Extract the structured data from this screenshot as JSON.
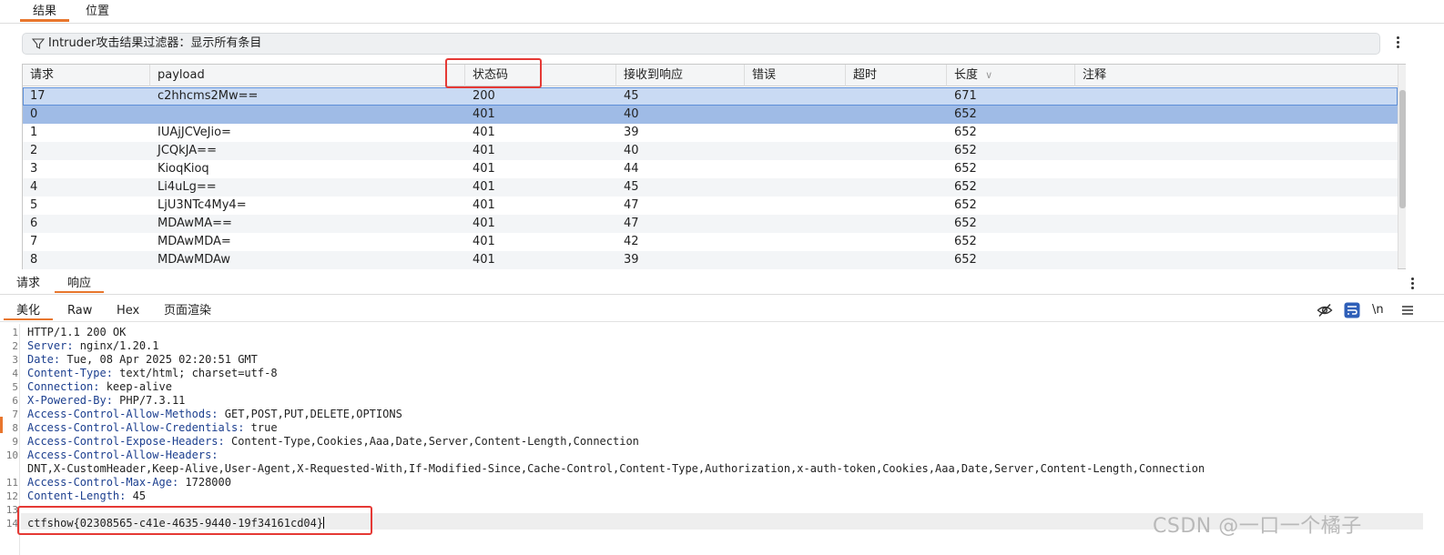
{
  "top_tabs": [
    {
      "label": "结果"
    },
    {
      "label": "位置"
    }
  ],
  "filter": {
    "text": "Intruder攻击结果过滤器：显示所有条目"
  },
  "table": {
    "columns": [
      {
        "label": "请求"
      },
      {
        "label": "payload"
      },
      {
        "label": "状态码"
      },
      {
        "label": "接收到响应"
      },
      {
        "label": "错误"
      },
      {
        "label": "超时"
      },
      {
        "label": "长度"
      },
      {
        "label": "注释"
      }
    ],
    "sort_indicator": "∨",
    "rows": [
      {
        "req": "17",
        "payload": "c2hhcms2Mw==",
        "status": "200",
        "resp": "45",
        "err": "",
        "timeout": "",
        "len": "671",
        "note": ""
      },
      {
        "req": "0",
        "payload": "",
        "status": "401",
        "resp": "40",
        "err": "",
        "timeout": "",
        "len": "652",
        "note": ""
      },
      {
        "req": "1",
        "payload": "IUAjJCVeJio=",
        "status": "401",
        "resp": "39",
        "err": "",
        "timeout": "",
        "len": "652",
        "note": ""
      },
      {
        "req": "2",
        "payload": "JCQkJA==",
        "status": "401",
        "resp": "40",
        "err": "",
        "timeout": "",
        "len": "652",
        "note": ""
      },
      {
        "req": "3",
        "payload": "KioqKioq",
        "status": "401",
        "resp": "44",
        "err": "",
        "timeout": "",
        "len": "652",
        "note": ""
      },
      {
        "req": "4",
        "payload": "Li4uLg==",
        "status": "401",
        "resp": "45",
        "err": "",
        "timeout": "",
        "len": "652",
        "note": ""
      },
      {
        "req": "5",
        "payload": "LjU3NTc4My4=",
        "status": "401",
        "resp": "47",
        "err": "",
        "timeout": "",
        "len": "652",
        "note": ""
      },
      {
        "req": "6",
        "payload": "MDAwMA==",
        "status": "401",
        "resp": "47",
        "err": "",
        "timeout": "",
        "len": "652",
        "note": ""
      },
      {
        "req": "7",
        "payload": "MDAwMDA=",
        "status": "401",
        "resp": "42",
        "err": "",
        "timeout": "",
        "len": "652",
        "note": ""
      },
      {
        "req": "8",
        "payload": "MDAwMDAw",
        "status": "401",
        "resp": "39",
        "err": "",
        "timeout": "",
        "len": "652",
        "note": ""
      }
    ]
  },
  "sub_tabs": [
    {
      "label": "请求"
    },
    {
      "label": "响应"
    }
  ],
  "view_tabs": [
    {
      "label": "美化"
    },
    {
      "label": "Raw"
    },
    {
      "label": "Hex"
    },
    {
      "label": "页面渲染"
    }
  ],
  "newline_toggle": "\\n",
  "response": {
    "line_numbers": [
      "1",
      "2",
      "3",
      "4",
      "5",
      "6",
      "7",
      "8",
      "9",
      "10",
      "11",
      "12",
      "13",
      "14"
    ],
    "status_line": "HTTP/1.1 200 OK",
    "headers": [
      {
        "name": "Server:",
        "value": " nginx/1.20.1"
      },
      {
        "name": "Date:",
        "value": " Tue, 08 Apr 2025 02:20:51 GMT"
      },
      {
        "name": "Content-Type:",
        "value": " text/html; charset=utf-8"
      },
      {
        "name": "Connection:",
        "value": " keep-alive"
      },
      {
        "name": "X-Powered-By:",
        "value": " PHP/7.3.11"
      },
      {
        "name": "Access-Control-Allow-Methods:",
        "value": " GET,POST,PUT,DELETE,OPTIONS"
      },
      {
        "name": "Access-Control-Allow-Credentials:",
        "value": " true"
      },
      {
        "name": "Access-Control-Expose-Headers:",
        "value": " Content-Type,Cookies,Aaa,Date,Server,Content-Length,Connection"
      },
      {
        "name": "Access-Control-Allow-Headers:",
        "value": ""
      },
      {
        "name": "",
        "value": "DNT,X-CustomHeader,Keep-Alive,User-Agent,X-Requested-With,If-Modified-Since,Cache-Control,Content-Type,Authorization,x-auth-token,Cookies,Aaa,Date,Server,Content-Length,Connection"
      },
      {
        "name": "Access-Control-Max-Age:",
        "value": " 1728000"
      },
      {
        "name": "Content-Length:",
        "value": " 45"
      }
    ],
    "body": "ctfshow{02308565-c41e-4635-9440-19f34161cd04}"
  },
  "watermark": "CSDN @一口一个橘子",
  "colors": {
    "accent": "#e8762d",
    "highlight": "#e53935",
    "selection": "#9fbbe6",
    "header_name": "#1c3f8f"
  }
}
